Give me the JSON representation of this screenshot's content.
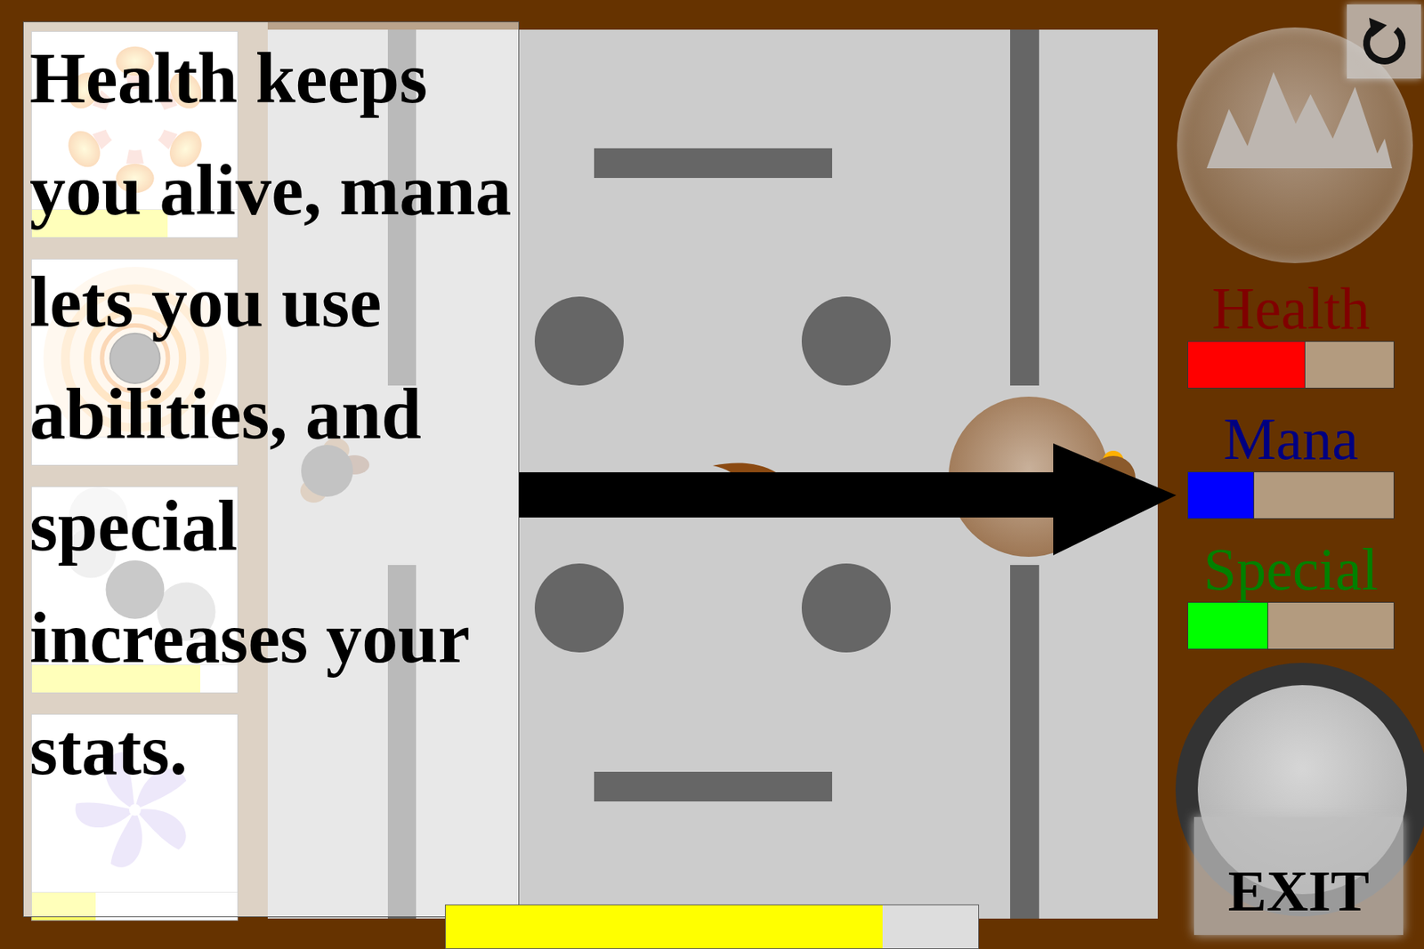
{
  "tutorial": {
    "text": "Health keeps you alive, mana lets you use abilities, and special increases your stats."
  },
  "abilities": [
    {
      "kind": "flower",
      "level": 0.66
    },
    {
      "kind": "rings",
      "level": 0
    },
    {
      "kind": "orbs",
      "level": 0.82
    },
    {
      "kind": "pinwheel",
      "level": 0.31
    }
  ],
  "stats": [
    {
      "label": "Health",
      "level": 0.57,
      "color": "#ff0000",
      "label_color": "#800000"
    },
    {
      "label": "Mana",
      "level": 0.32,
      "color": "#0000ff",
      "label_color": "#000080"
    },
    {
      "label": "Special",
      "level": 0.39,
      "color": "#00ff00",
      "label_color": "#008000"
    }
  ],
  "experience": {
    "level": 0.82
  },
  "exit_button": {
    "label": "EXIT"
  }
}
